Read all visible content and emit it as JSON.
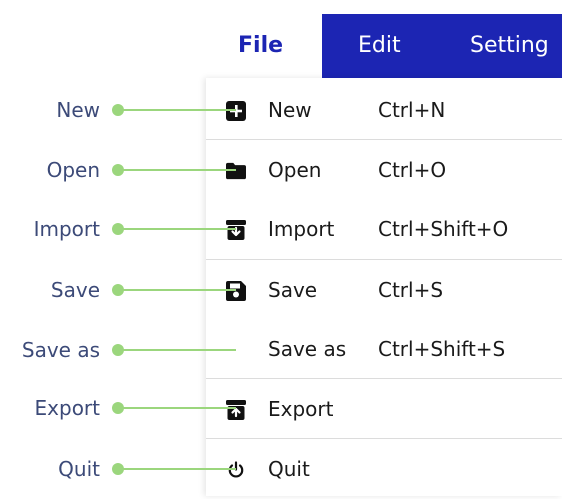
{
  "menubar": {
    "tabs": [
      {
        "label": "File",
        "active": true
      },
      {
        "label": "Edit",
        "active": false
      },
      {
        "label": "Setting",
        "active": false
      }
    ],
    "accent_color": "#1c25b3"
  },
  "file_menu": {
    "items": [
      {
        "label": "New",
        "shortcut": "Ctrl+N",
        "icon": "plus-square-icon"
      },
      {
        "label": "Open",
        "shortcut": "Ctrl+O",
        "icon": "folder-icon"
      },
      {
        "label": "Import",
        "shortcut": "Ctrl+Shift+O",
        "icon": "import-box-icon"
      },
      {
        "label": "Save",
        "shortcut": "Ctrl+S",
        "icon": "floppy-disk-icon"
      },
      {
        "label": "Save as",
        "shortcut": "Ctrl+Shift+S",
        "icon": ""
      },
      {
        "label": "Export",
        "shortcut": "",
        "icon": "export-box-icon"
      },
      {
        "label": "Quit",
        "shortcut": "",
        "icon": "power-icon"
      }
    ]
  },
  "callouts": {
    "labels": [
      "New",
      "Open",
      "Import",
      "Save",
      "Save as",
      "Export",
      "Quit"
    ],
    "label_color": "#3c4a78",
    "line_color": "#9bd67d"
  }
}
